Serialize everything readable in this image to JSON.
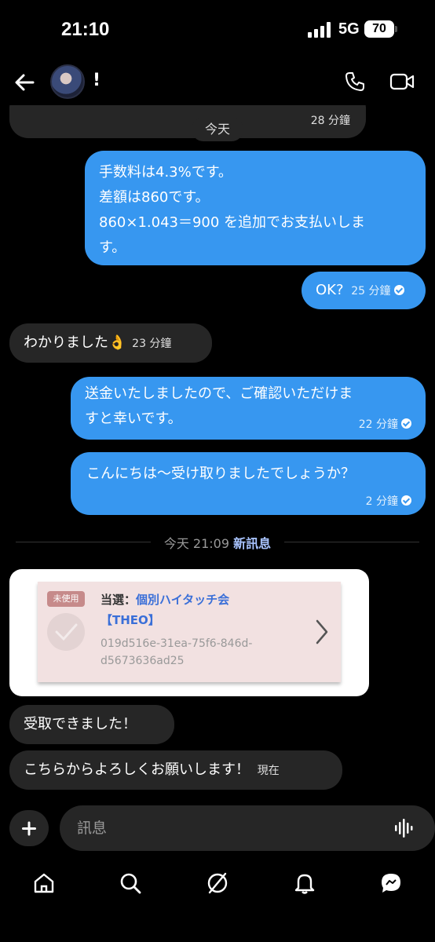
{
  "status": {
    "time": "21:10",
    "network": "5G",
    "battery": "70"
  },
  "header": {
    "contact_name": "!"
  },
  "chat": {
    "day_pill": "今天",
    "top_partial_time": "28 分鐘",
    "messages": [
      {
        "lines": [
          "手数料は4.3%です。",
          "差額は860です。",
          "860×1.043＝900 を追加でお支払いしま",
          "す。"
        ]
      },
      {
        "text": "OK?",
        "time": "25 分鐘"
      },
      {
        "text": "わかりました👌",
        "time": "23 分鐘"
      },
      {
        "lines": [
          "送金いたしましたので、ご確認いただけま",
          "すと幸いです。"
        ],
        "time": "22 分鐘"
      },
      {
        "text": "こんにちは～受け取りましたでしょうか？",
        "time": "2 分鐘"
      }
    ],
    "divider": {
      "time": "今天 21:09",
      "label": "新訊息"
    },
    "ticket": {
      "tag": "未使用",
      "title_prefix": "当選：",
      "title_value": "個別ハイタッチ会",
      "title_line2": "【THEO】",
      "code_line1": "019d516e-31ea-75f6-846d-",
      "code_line2": "d5673636ad25"
    },
    "replies": [
      {
        "text": "受取できました！"
      },
      {
        "text": "こちらからよろしくお願いします！",
        "time": "現在"
      }
    ]
  },
  "composer": {
    "placeholder": "訊息"
  },
  "colors": {
    "outgoing": "#3797f0",
    "incoming": "#262626",
    "background": "#000000"
  },
  "icons": {
    "header": [
      "back-arrow-icon",
      "phone-icon",
      "video-camera-icon"
    ],
    "nav": [
      "home-icon",
      "search-icon",
      "explore-icon",
      "notifications-icon",
      "messages-icon"
    ]
  }
}
